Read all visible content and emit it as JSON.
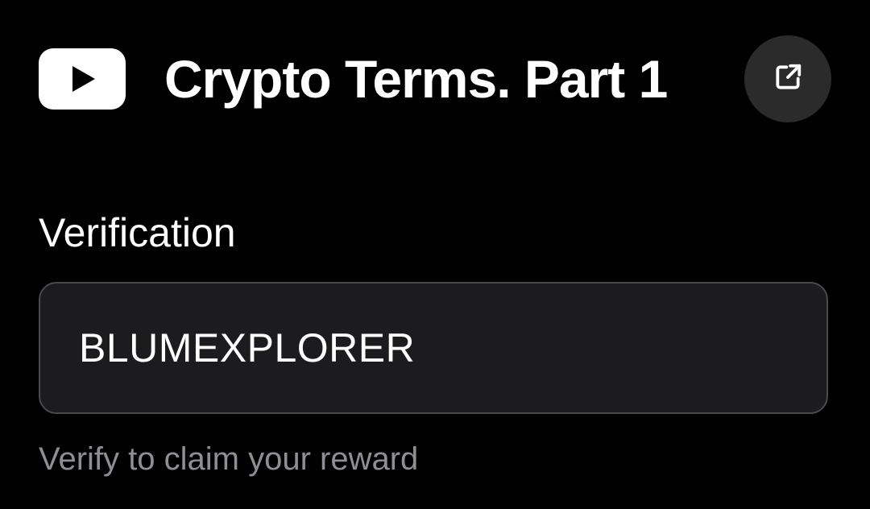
{
  "header": {
    "title": "Crypto Terms. Part 1",
    "logo_icon": "youtube-logo-icon",
    "open_button_icon": "external-link-icon"
  },
  "verification": {
    "label": "Verification",
    "input_value": "BLUMEXPLORER",
    "helper_text": "Verify to claim your reward"
  },
  "colors": {
    "background": "#000000",
    "input_background": "#1c1c1e",
    "input_border": "#4a4a4c",
    "button_background": "#2b2b2b",
    "helper_text": "#8e8e93"
  }
}
